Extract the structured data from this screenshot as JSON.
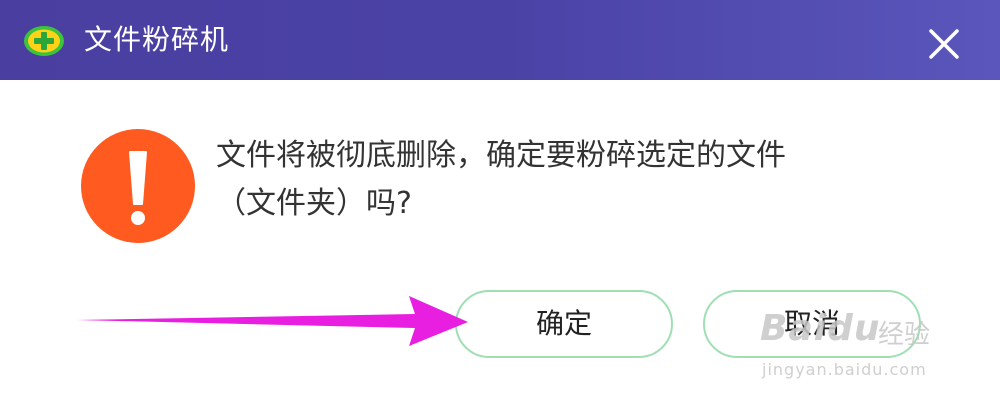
{
  "window": {
    "title": "文件粉碎机",
    "icon": "360-plus-logo-icon",
    "close_icon": "close-icon",
    "titlebar_color": "#4b42a6"
  },
  "dialog": {
    "warning_icon": "exclamation-warning-icon",
    "warning_color": "#ff5a1f",
    "message_line1": "文件将被彻底删除，确定要粉碎选定的文件",
    "message_line2": "（文件夹）吗?"
  },
  "buttons": {
    "confirm_label": "确定",
    "cancel_label": "取消",
    "border_color": "#9fdfb3"
  },
  "annotation": {
    "arrow_icon": "arrow-right-icon",
    "arrow_color": "#e81ee0"
  },
  "watermark": {
    "brand": "Baidu",
    "text": "经验",
    "url": "jingyan.baidu.com"
  }
}
